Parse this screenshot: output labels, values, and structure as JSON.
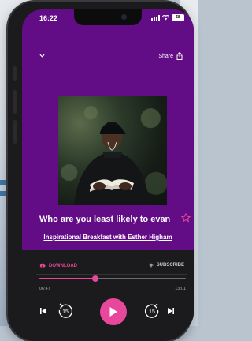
{
  "status_bar": {
    "time": "16:22",
    "battery": "58"
  },
  "header": {
    "share_label": "Share"
  },
  "episode": {
    "title": "Who are you least likely to evan",
    "show": "Inspirational Breakfast with Esther Higham"
  },
  "actions": {
    "download_label": "DOWNLOAD",
    "subscribe_label": "SUBSCRIBE"
  },
  "player": {
    "elapsed": "06:47",
    "duration": "13:01",
    "progress": 0.38
  },
  "icons": [
    "chevron-down-icon",
    "share-icon",
    "star-icon",
    "download-icon",
    "plus-icon",
    "skip-previous-icon",
    "rewind-15-icon",
    "play-icon",
    "forward-15-icon",
    "skip-next-icon"
  ],
  "colors": {
    "background": "#620d86",
    "accent": "#e8489b",
    "player_bg": "#1b1b1d"
  }
}
